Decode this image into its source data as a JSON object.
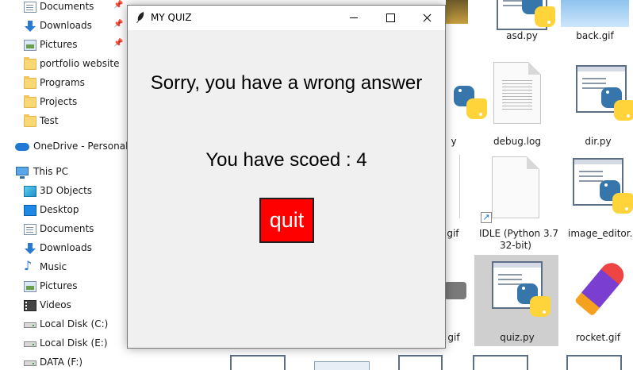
{
  "sidebar": {
    "items": [
      {
        "label": "Documents",
        "icon": "documents-icon",
        "pinned": true
      },
      {
        "label": "Downloads",
        "icon": "downloads-icon",
        "pinned": true
      },
      {
        "label": "Pictures",
        "icon": "pictures-icon",
        "pinned": true
      },
      {
        "label": "portfolio website",
        "icon": "folder-icon"
      },
      {
        "label": "Programs",
        "icon": "folder-icon"
      },
      {
        "label": "Projects",
        "icon": "folder-icon"
      },
      {
        "label": "Test",
        "icon": "folder-icon"
      },
      {
        "label": "OneDrive - Personal",
        "icon": "onedrive-icon"
      },
      {
        "label": "This PC",
        "icon": "this-pc-icon"
      },
      {
        "label": "3D Objects",
        "icon": "3d-objects-icon"
      },
      {
        "label": "Desktop",
        "icon": "desktop-icon"
      },
      {
        "label": "Documents",
        "icon": "documents-icon"
      },
      {
        "label": "Downloads",
        "icon": "downloads-icon"
      },
      {
        "label": "Music",
        "icon": "music-icon"
      },
      {
        "label": "Pictures",
        "icon": "pictures-icon"
      },
      {
        "label": "Videos",
        "icon": "videos-icon"
      },
      {
        "label": "Local Disk (C:)",
        "icon": "disk-icon"
      },
      {
        "label": "Local Disk (E:)",
        "icon": "disk-icon"
      },
      {
        "label": "DATA (F:)",
        "icon": "disk-icon"
      }
    ]
  },
  "files": {
    "asd": "asd.py",
    "back": "back.gif",
    "partial_y": "y",
    "debug": "debug.log",
    "dir": "dir.py",
    "partial_ali": "ali.gif",
    "idle_line1": "IDLE (Python 3.7",
    "idle_line2": "32-bit)",
    "image_editor": "image_editor.py",
    "partial_gif": "gif",
    "quiz": "quiz.py",
    "rocket": "rocket.gif"
  },
  "quiz_window": {
    "title": "MY QUIZ",
    "result_message": "Sorry, you have a wrong answer",
    "score_message": "You have scoed : 4",
    "quit_label": "quit",
    "quit_color": "#ff0000"
  }
}
